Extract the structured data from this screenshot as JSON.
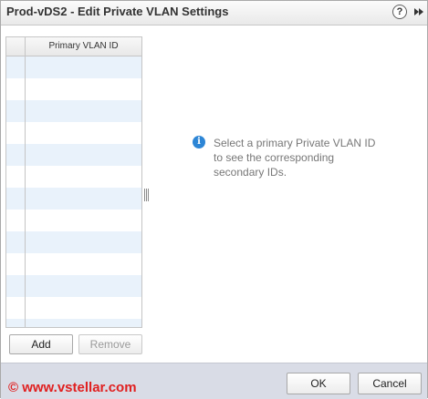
{
  "dialog": {
    "title": "Prod-vDS2 - Edit Private VLAN Settings",
    "help_icon": "?",
    "expand_icon": "double-chevron-right"
  },
  "list": {
    "column_header": "Primary VLAN ID",
    "rows": [
      "",
      "",
      "",
      "",
      "",
      "",
      "",
      "",
      "",
      "",
      "",
      "",
      ""
    ],
    "add_label": "Add",
    "remove_label": "Remove"
  },
  "info": {
    "icon": "info-icon",
    "lines": [
      "Select a primary Private VLAN ID",
      "to see the corresponding",
      "secondary IDs."
    ]
  },
  "footer": {
    "watermark": "© www.vstellar.com",
    "ok_label": "OK",
    "cancel_label": "Cancel"
  },
  "colors": {
    "row_alt": "#e9f2fb",
    "footer_bg": "#d9dce6",
    "info_icon": "#2d86d6",
    "watermark": "#e02020"
  }
}
